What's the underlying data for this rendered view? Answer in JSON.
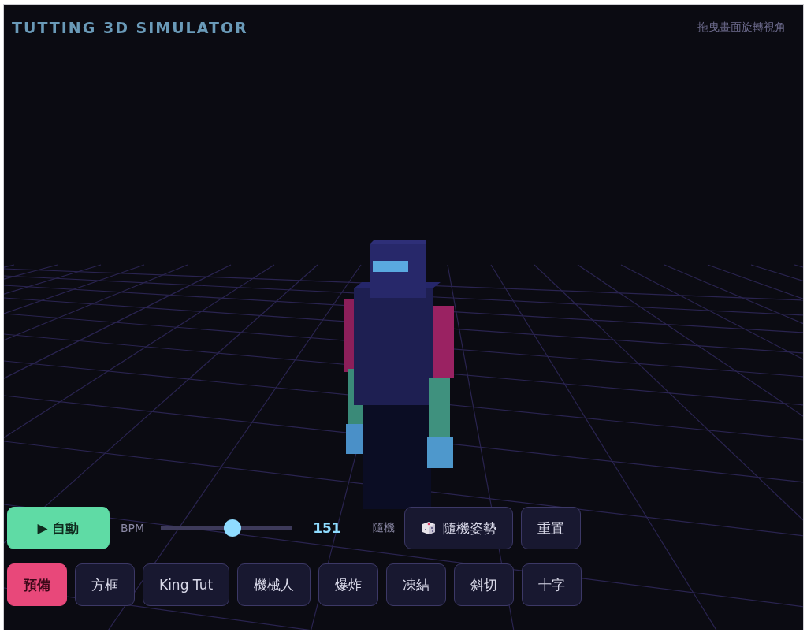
{
  "title": "TUTTING 3D SIMULATOR",
  "hint": "拖曳畫面旋轉視角",
  "auto_button": {
    "icon": "▶",
    "label": "自動"
  },
  "bpm": {
    "label": "BPM",
    "level": 0.55,
    "reading": "151"
  },
  "random_label": "隨機",
  "random_pose_button": "隨機姿勢",
  "reset_button": "重置",
  "poses": [
    {
      "label": "預備",
      "selected": true
    },
    {
      "label": "方框",
      "selected": false
    },
    {
      "label": "King Tut",
      "selected": false
    },
    {
      "label": "機械人",
      "selected": false
    },
    {
      "label": "爆炸",
      "selected": false
    },
    {
      "label": "凍結",
      "selected": false
    },
    {
      "label": "斜切",
      "selected": false
    },
    {
      "label": "十字",
      "selected": false
    }
  ]
}
